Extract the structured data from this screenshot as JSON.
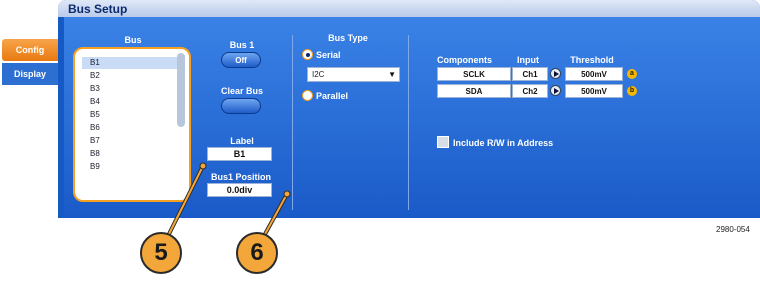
{
  "window": {
    "title": "Bus Setup"
  },
  "side_tabs": [
    {
      "label": "Config",
      "active": true
    },
    {
      "label": "Display",
      "active": false
    }
  ],
  "bus_list": {
    "header": "Bus",
    "items": [
      "B1",
      "B2",
      "B3",
      "B4",
      "B5",
      "B6",
      "B7",
      "B8",
      "B9"
    ],
    "selected": "B1"
  },
  "bus1": {
    "label": "Bus 1",
    "toggle": "Off"
  },
  "clear_bus": {
    "label": "Clear Bus"
  },
  "label_field": {
    "label": "Label",
    "value": "B1"
  },
  "position_field": {
    "label": "Bus1 Position",
    "value": "0.0div"
  },
  "bus_type": {
    "header": "Bus Type",
    "serial_label": "Serial",
    "parallel_label": "Parallel",
    "selected": "Serial",
    "protocol": "I2C"
  },
  "components_table": {
    "headers": [
      "Components",
      "Input",
      "Threshold"
    ],
    "rows": [
      {
        "component": "SCLK",
        "input": "Ch1",
        "threshold": "500mV",
        "badge": "a"
      },
      {
        "component": "SDA",
        "input": "Ch2",
        "threshold": "500mV",
        "badge": "b"
      }
    ]
  },
  "include_rw": {
    "label": "Include R/W in Address",
    "checked": false
  },
  "figure_code": "2980-054",
  "callouts": [
    "5",
    "6"
  ],
  "colors": {
    "accent": "#f5a020",
    "panel": "#1a5ac8",
    "title_bar": "#c9d8f0"
  }
}
